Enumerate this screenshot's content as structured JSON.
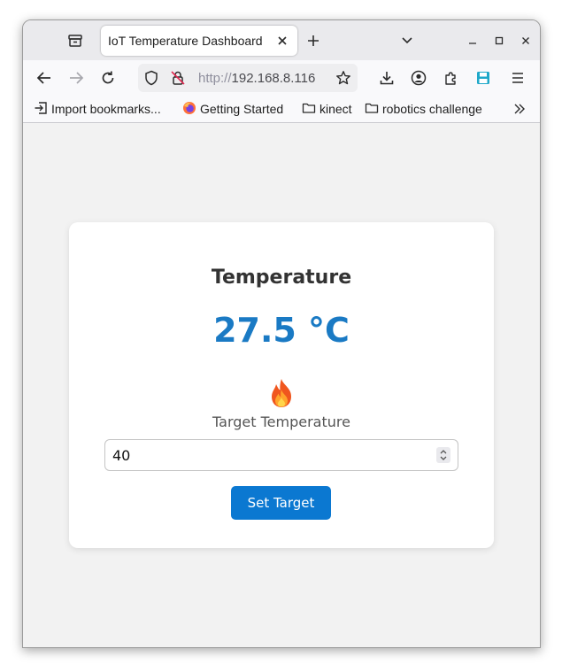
{
  "browser": {
    "tab": {
      "title": "IoT Temperature Dashboard"
    },
    "url": {
      "scheme": "http://",
      "host": "192.168.8.116"
    },
    "bookmarks": [
      {
        "label": "Import bookmarks...",
        "icon": "import-icon"
      },
      {
        "label": "Getting Started",
        "icon": "firefox-icon"
      },
      {
        "label": "kinect",
        "icon": "folder-icon"
      },
      {
        "label": "robotics challenge",
        "icon": "folder-icon"
      }
    ]
  },
  "dashboard": {
    "title": "Temperature",
    "temperature": "27.5 °C",
    "status_icon": "fire-icon",
    "target_label": "Target Temperature",
    "target_value": "40",
    "set_button": "Set Target"
  },
  "colors": {
    "accent": "#0b78d1",
    "temperature_text": "#1a7ac4",
    "page_background": "#f2f2f2"
  }
}
